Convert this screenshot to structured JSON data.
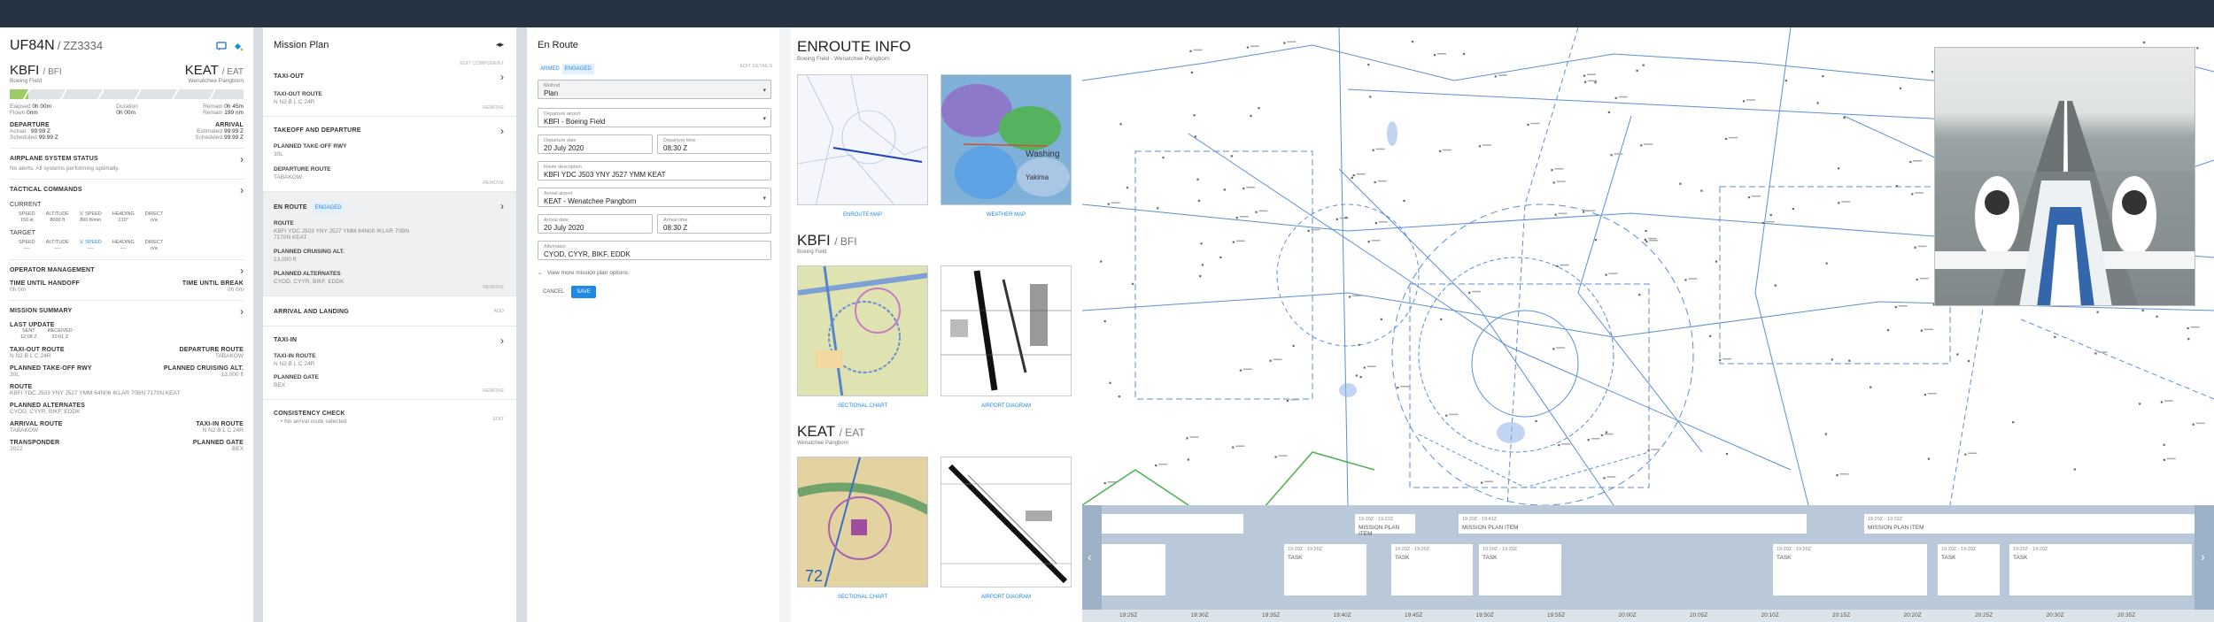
{
  "flight": {
    "callsign": "UF84N",
    "tail": "ZZ3334",
    "origin": {
      "code": "KBFI",
      "iata": "BFI",
      "name": "Boeing Field"
    },
    "dest": {
      "code": "KEAT",
      "iata": "EAT",
      "name": "Wenatchee Pangborn"
    },
    "progress": 0.08,
    "elapsed_label": "Elapsed",
    "elapsed": "0h 00m",
    "flown_label": "Flown",
    "flown": "0nm",
    "duration_label": "Duration",
    "duration": "0h 00m",
    "remain_label": "Remain",
    "remain_time": "0h 45m",
    "remain2_label": "Remain",
    "remain_nm": "199 nm",
    "departure_label": "DEPARTURE",
    "arrival_label": "ARRIVAL",
    "actual_label": "Actual",
    "actual": "99:99 Z",
    "scheduled_label": "Scheduled",
    "scheduled": "99:99 Z",
    "estimated_label": "Estimated",
    "estimated": "99:99 Z",
    "scheduled2_label": "Scheduled",
    "scheduled2": "99:99 Z"
  },
  "left": {
    "system_status": "AIRPLANE SYSTEM STATUS",
    "system_status_text": "No alerts. All systems performing optimally.",
    "tactical": "TACTICAL COMMANDS",
    "current": "CURRENT",
    "target": "TARGET",
    "cmds": [
      {
        "label": "SPEED",
        "cur": "150 kt",
        "tgt": "----"
      },
      {
        "label": "ALTITUDE",
        "cur": "8000 ft",
        "tgt": "----"
      },
      {
        "label": "V. SPEED",
        "cur": "800 ft/min",
        "tgt": "----"
      },
      {
        "label": "HEADING",
        "cur": "210°",
        "tgt": "----"
      },
      {
        "label": "DIRECT",
        "cur": "n/a",
        "tgt": "n/a"
      }
    ],
    "operator": "OPERATOR MANAGEMENT",
    "handoff_label": "TIME UNTIL HANDOFF",
    "handoff": "0h 0m",
    "break_label": "TIME UNTIL BREAK",
    "break": "0h 0m",
    "summary": "MISSION SUMMARY",
    "last_update": "LAST UPDATE",
    "sent_label": "SENT",
    "sent": "12:08 Z",
    "received_label": "RECEIVED",
    "received": "10:01 Z",
    "taxi_out_route_label": "TAXI-OUT ROUTE",
    "taxi_out_route": "N N2 B L C 24R",
    "departure_route_label": "DEPARTURE ROUTE",
    "departure_route": "TABAKOW",
    "takeoff_rwy_label": "PLANNED TAKE-OFF RWY",
    "takeoff_rwy": "30L",
    "cruise_label": "PLANNED CRUISING ALT.",
    "cruise": "13,000 ft",
    "route_label": "ROUTE",
    "route": "KBFI YDC J503 YNY J527 YMM 64N06 IKLAR 70BN 7170N KEAT",
    "alternates_label": "PLANNED ALTERNATES",
    "alternates": "CYOD, CYYR, BIKF, EDDK",
    "arrival_route_label": "ARRIVAL ROUTE",
    "arrival_route": "TABAKOW",
    "taxi_in_route_label": "TAXI-IN ROUTE",
    "taxi_in_route": "N N2 B L C 24R",
    "transponder_label": "TRANSPONDER",
    "transponder": "2022",
    "gate_label": "PLANNED GATE",
    "gate": "BEX"
  },
  "mission": {
    "title": "Mission Plan",
    "edit_component": "EDIT COMPONENT",
    "taxi_out": "TAXI-OUT",
    "taxi_out_route_label": "TAXI-OUT ROUTE",
    "taxi_out_route": "N N2 B L C 24R",
    "remove": "REMOVE",
    "takeoff": "TAKEOFF AND DEPARTURE",
    "takeoff_rwy_label": "PLANNED TAKE-OFF RWY",
    "takeoff_rwy": "30L",
    "departure_route_label": "DEPARTURE ROUTE",
    "departure_route": "TABAKOW",
    "enroute": "EN ROUTE",
    "engaged": "ENGAGED",
    "route_label": "ROUTE",
    "route": "KBFI YDC J503 YNY J527 YMM 64N00 IKLAR 70BN 7170N KEAT",
    "cruise_label": "PLANNED CRUISING ALT.",
    "cruise": "13,000 ft",
    "alternates_label": "PLANNED ALTERNATES",
    "alternates": "CYOD, CYYR, BIKF, EDDK",
    "arrival": "ARRIVAL AND LANDING",
    "add": "ADD",
    "taxi_in": "TAXI-IN",
    "taxi_in_route_label": "TAXI-IN ROUTE",
    "taxi_in_route": "N N2 B L C 24R",
    "gate_label": "PLANNED GATE",
    "gate": "BEX",
    "consistency": "CONSISTENCY CHECK",
    "consistency_item": "• No arrival route selected",
    "edit": "EDIT"
  },
  "enroute_form": {
    "title": "En Route",
    "armed": "ARMED",
    "engaged": "ENGAGED",
    "edit_details": "EDIT DETAILS",
    "method_label": "Method",
    "method": "Plan",
    "dep_airport_label": "Departure airport",
    "dep_airport": "KBFI - Boeing Field",
    "dep_date_label": "Departure date",
    "dep_date": "20 July 2020",
    "dep_time_label": "Departure time",
    "dep_time": "08:30 Z",
    "route_label": "Route description",
    "route": "KBFI YDC J503 YNY J527 YMM KEAT",
    "arr_airport_label": "Arrival airport",
    "arr_airport": "KEAT - Wenatchee Pangborn",
    "arr_date_label": "Arrival date",
    "arr_date": "20 July 2020",
    "arr_time_label": "Arrival time",
    "arr_time": "08:30 Z",
    "alternates_label": "Alternates",
    "alternates": "CYOD, CYYR, BIKF, EDDK",
    "more": "View more mission plan options",
    "cancel": "CANCEL",
    "save": "SAVE"
  },
  "info": {
    "title": "ENROUTE INFO",
    "subtitle": "Boeing Field - Wenatchee Pangborn",
    "enroute_map": "ENROUTE MAP",
    "weather_map": "WEATHER MAP",
    "weather_city": "Yakima",
    "origin_code": "KBFI",
    "origin_iata": "BFI",
    "origin_name": "Boeing Field",
    "dest_code": "KEAT",
    "dest_iata": "EAT",
    "dest_name": "Wenatchee Pangborn",
    "sectional": "SECTIONAL CHART",
    "airport_diagram": "AIRPORT DIAGRAM"
  },
  "timeline": {
    "plans": [
      {
        "time": "19:20Z - 19:22Z",
        "label": "MISSION PLAN ITEM"
      },
      {
        "time": "19:20Z - 19:41Z",
        "label": "MISSION PLAN ITEM"
      },
      {
        "time": "19:20Z - 19:22Z",
        "label": "MISSION PLAN ITEM"
      }
    ],
    "tasks": [
      {
        "time": "19:20Z - 19:20Z",
        "label": "TASK"
      },
      {
        "time": "19:20Z - 19:20Z",
        "label": "TASK"
      },
      {
        "time": "19:20Z - 19:20Z",
        "label": "TASK"
      },
      {
        "time": "19:20Z - 19:20Z",
        "label": "TASK"
      },
      {
        "time": "19:20Z - 19:20Z",
        "label": "TASK"
      },
      {
        "time": "19:20Z - 19:20Z",
        "label": "TASK"
      }
    ],
    "ticks": [
      "19:25Z",
      "19:30Z",
      "19:35Z",
      "19:40Z",
      "19:45Z",
      "19:50Z",
      "19:55Z",
      "20:00Z",
      "20:05Z",
      "20:10Z",
      "20:15Z",
      "20:20Z",
      "20:25Z",
      "20:30Z",
      "20:35Z"
    ]
  },
  "colors": {
    "accent": "#1e88e5",
    "topbar": "#263344",
    "progress": "#9ccc65",
    "map_lines": "#5b8ed6"
  }
}
